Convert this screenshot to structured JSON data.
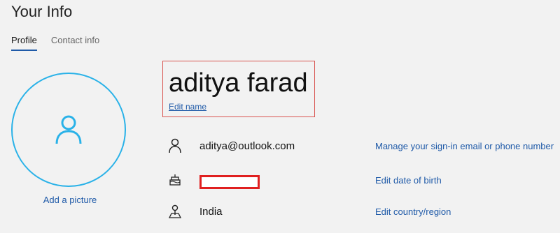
{
  "page": {
    "title": "Your Info"
  },
  "tabs": [
    {
      "label": "Profile",
      "active": true
    },
    {
      "label": "Contact info",
      "active": false
    }
  ],
  "avatar": {
    "icon": "person-icon",
    "add_picture_label": "Add a picture"
  },
  "profile": {
    "name": "aditya farad",
    "edit_name_label": "Edit name"
  },
  "rows": [
    {
      "icon": "person-icon",
      "value": "aditya@outlook.com",
      "action": "Manage your sign-in email or phone number"
    },
    {
      "icon": "birthday-cake-icon",
      "value": "",
      "redacted": true,
      "action": "Edit date of birth"
    },
    {
      "icon": "map-pin-icon",
      "value": "India",
      "action": "Edit country/region"
    }
  ],
  "colors": {
    "accent": "#1f5aa8",
    "avatar_ring": "#2ab2e8",
    "highlight_border": "#d9534f",
    "redaction": "#e02020"
  }
}
